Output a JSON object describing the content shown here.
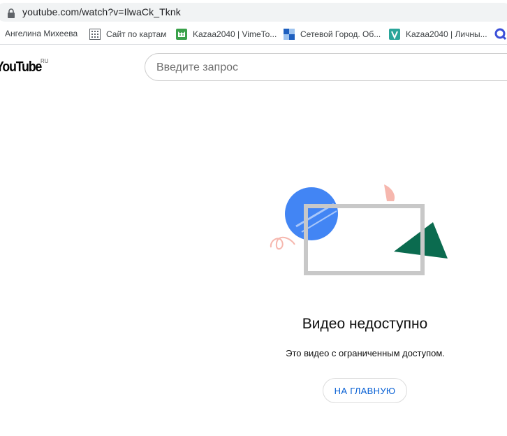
{
  "browser": {
    "url": "youtube.com/watch?v=IlwaCk_Tknk",
    "bookmarks": [
      {
        "label": "Ангелина Михеева",
        "icon": "none"
      },
      {
        "label": "Сайт по картам",
        "icon": "apps-grid-icon"
      },
      {
        "label": "Kazaa2040 | VimeTo...",
        "icon": "vimetop-icon"
      },
      {
        "label": "Сетевой Город. Об...",
        "icon": "netcity-icon"
      },
      {
        "label": "Kazaa2040 | Личны...",
        "icon": "vimeworld-icon"
      }
    ]
  },
  "header": {
    "logo_text": "YouTube",
    "region": "RU",
    "search_placeholder": "Введите запрос"
  },
  "main": {
    "title": "Видео недоступно",
    "subtitle": "Это видео с ограниченным доступом.",
    "home_button": "НА ГЛАВНУЮ"
  },
  "colors": {
    "accent_blue": "#065fd4",
    "illustration_blue": "#4285f4",
    "illustration_green": "#0b6b4f",
    "illustration_pink": "#f6b7ae"
  }
}
